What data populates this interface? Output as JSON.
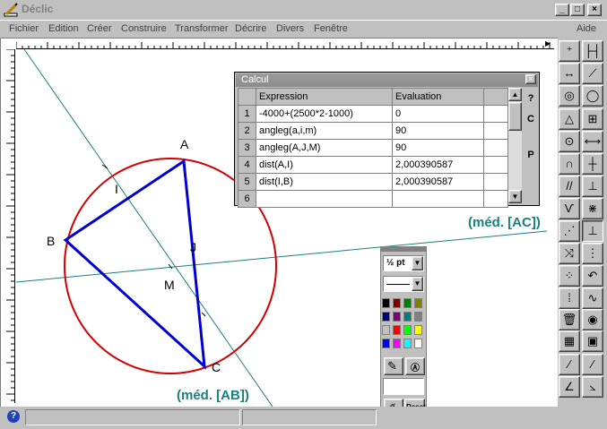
{
  "window": {
    "title": "Déclic",
    "app_icon": "pencil-ruler-icon",
    "buttons": [
      "minimize",
      "maximize",
      "close"
    ]
  },
  "menubar": {
    "items": [
      "Fichier",
      "Edition",
      "Créer",
      "Construire",
      "Transformer",
      "Décrire",
      "Divers",
      "Fenêtre"
    ],
    "help": "Aide"
  },
  "canvas": {
    "points": {
      "A": "A",
      "B": "B",
      "C": "C",
      "I": "I",
      "J": "J",
      "M": "M"
    },
    "labels": {
      "med_ac": "(méd. [AC])",
      "med_ab": "(méd. [AB])"
    },
    "colors": {
      "triangle": "#0000cc",
      "circle": "#cc0000",
      "mediator": "#1b7f7f"
    }
  },
  "calc": {
    "title": "Calcul",
    "headers": {
      "expression": "Expression",
      "evaluation": "Evaluation"
    },
    "rows": [
      {
        "n": "1",
        "expr": "-4000+(2500*2-1000)",
        "val": "0"
      },
      {
        "n": "2",
        "expr": "angleg(a,i,m)",
        "val": "90"
      },
      {
        "n": "3",
        "expr": "angleg(A,J,M)",
        "val": "90"
      },
      {
        "n": "4",
        "expr": "dist(A,I)",
        "val": "2,000390587"
      },
      {
        "n": "5",
        "expr": "dist(I,B)",
        "val": "2,000390587"
      },
      {
        "n": "6",
        "expr": "",
        "val": ""
      }
    ],
    "side_buttons": [
      "?",
      "C",
      "P"
    ]
  },
  "palette": {
    "line_width": "½ pt",
    "reset": "Reset",
    "colors": [
      [
        "#000000",
        "#800000",
        "#008000",
        "#808000"
      ],
      [
        "#000080",
        "#800080",
        "#008080",
        "#808080"
      ],
      [
        "#c0c0c0",
        "#ff0000",
        "#00ff00",
        "#ffff00"
      ],
      [
        "#0000ff",
        "#ff00ff",
        "#00ffff",
        "#ffffff"
      ]
    ]
  },
  "status": {
    "help_icon": "question-icon"
  }
}
